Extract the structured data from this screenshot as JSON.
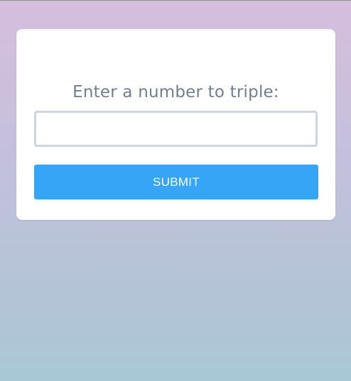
{
  "form": {
    "prompt": "Enter a number to triple:",
    "input_value": "",
    "input_placeholder": "",
    "submit_label": "SUBMIT"
  },
  "colors": {
    "background_top": "#d6bedd",
    "background_bottom": "#a8c8d6",
    "card": "#ffffff",
    "prompt_text": "#6f7f93",
    "input_border": "#cdd5df",
    "button": "#36a5f5",
    "button_text": "#ffffff"
  }
}
